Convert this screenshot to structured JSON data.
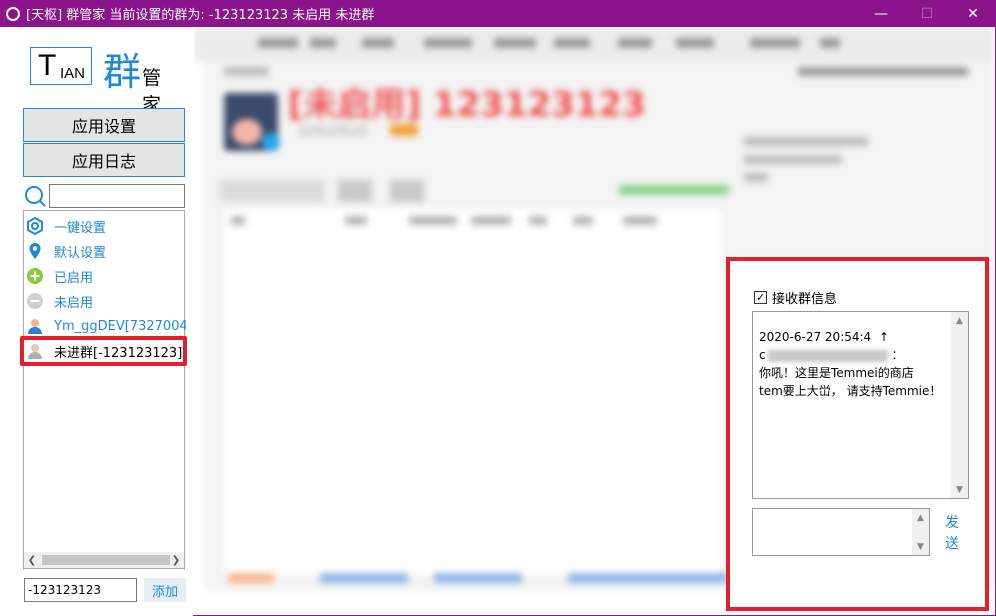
{
  "window": {
    "title": "[天枢] 群管家 当前设置的群为: -123123123 未启用  未进群",
    "minimize_glyph": "—",
    "maximize_glyph": "☐",
    "close_glyph": "✕",
    "accent_color": "#8b138b"
  },
  "logo": {
    "t": "T",
    "ian": "IAN",
    "qun": "群",
    "guanjia": "管家"
  },
  "sidebar": {
    "buttons": {
      "app_settings": "应用设置",
      "app_log": "应用日志"
    },
    "search": {
      "value": ""
    },
    "tree": [
      {
        "label": "一键设置",
        "icon": "hexagon-gear-icon"
      },
      {
        "label": "默认设置",
        "icon": "location-pin-icon"
      },
      {
        "label": "已启用",
        "icon": "green-plus-icon"
      },
      {
        "label": "未启用",
        "icon": "grey-minus-icon"
      },
      {
        "label": "Ym_ggDEV[7327004",
        "icon": "user-icon"
      },
      {
        "label": "未进群[-123123123]",
        "icon": "user-grey-icon",
        "selected": true
      }
    ],
    "add_input_value": "-123123123",
    "add_button": "添加"
  },
  "main_blurred": {
    "group_title": "[未启用] 123123123",
    "group_id": "123123123"
  },
  "chat_popup": {
    "receive_checkbox_label": "接收群信息",
    "receive_checked": true,
    "checkmark_glyph": "✓",
    "messages": [
      {
        "time": "2020-6-27 20:54:4",
        "arrow": "↑",
        "sender_prefix": "c",
        "sender_suffix": "：",
        "lines": [
          "你吼！这里是Temmei的商店",
          "tem要上大峃， 请支持Temmie！"
        ]
      }
    ],
    "send_button": "发送",
    "highlight_color": "#e0202a"
  }
}
